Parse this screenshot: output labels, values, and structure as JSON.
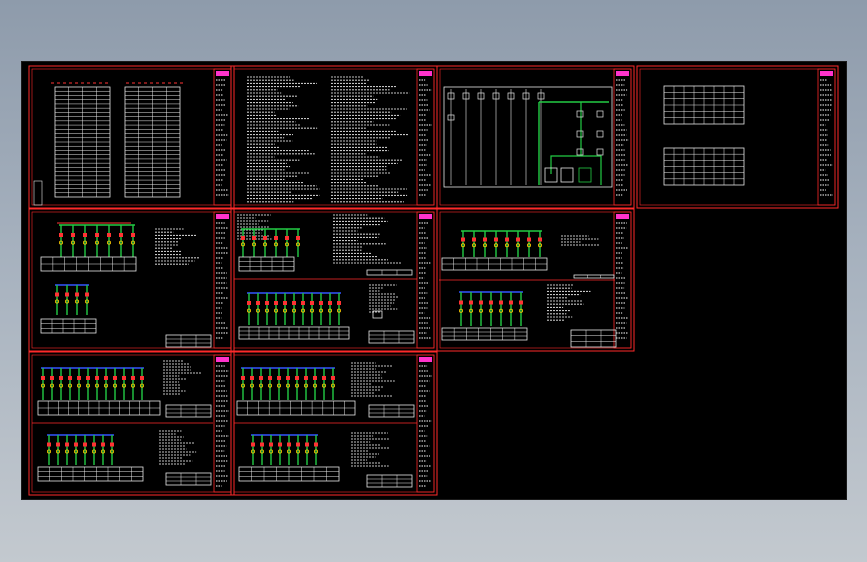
{
  "colors": {
    "background": "#000000",
    "sheet_border": "#ff2a2a",
    "conductor": "#22cc44",
    "text": "#e8e8e8",
    "table_line": "#e8e8e8",
    "title_block": "#ffffff",
    "accent_magenta": "#ff33cc",
    "bus_blue": "#3355ff",
    "breaker_red": "#ff3333",
    "device_yellow": "#ffcc00"
  },
  "drawing": {
    "sheet_count": 14,
    "visible_text": []
  }
}
